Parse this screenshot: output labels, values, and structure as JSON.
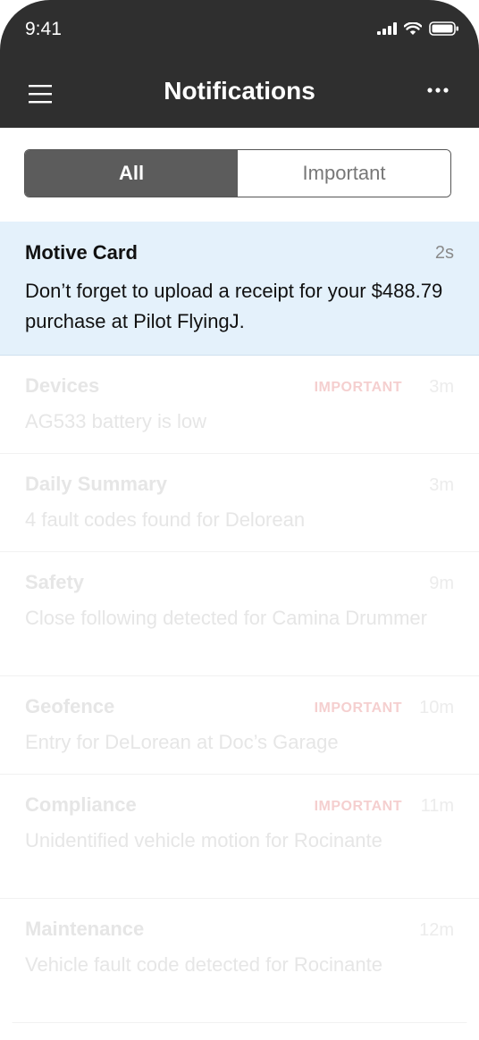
{
  "status_bar": {
    "time": "9:41"
  },
  "header": {
    "title": "Notifications"
  },
  "tabs": {
    "all_label": "All",
    "important_label": "Important"
  },
  "notifications": [
    {
      "source": "Motive Card",
      "message": "Don’t forget to upload a receipt for your $488.79 purchase at Pilot FlyingJ.",
      "age": "2s",
      "badge": ""
    },
    {
      "source": "Devices",
      "message": "AG533 battery is low",
      "age": "3m",
      "badge": "IMPORTANT"
    },
    {
      "source": "Daily Summary",
      "message": "4 fault codes found for Delorean",
      "age": "3m",
      "badge": ""
    },
    {
      "source": "Safety",
      "message": "Close following detected for Camina Drummer",
      "age": "9m",
      "badge": ""
    },
    {
      "source": "Geofence",
      "message": "Entry for DeLorean at Doc’s Garage",
      "age": "10m",
      "badge": "IMPORTANT"
    },
    {
      "source": "Compliance",
      "message": "Unidentified vehicle motion for Rocinante",
      "age": "11m",
      "badge": "IMPORTANT"
    },
    {
      "source": "Maintenance",
      "message": "Vehicle fault code detected for Rocinante",
      "age": "12m",
      "badge": ""
    }
  ],
  "icons": {
    "menu": "hamburger-menu-icon",
    "more": "more-horizontal-icon",
    "signal": "cellular-signal-icon",
    "wifi": "wifi-icon",
    "battery": "battery-icon"
  },
  "colors": {
    "header_bg": "#2f2f2f",
    "active_row_bg": "#e4f1fb",
    "important_badge": "#f5cfcf",
    "tab_selected_bg": "#5c5c5c"
  }
}
